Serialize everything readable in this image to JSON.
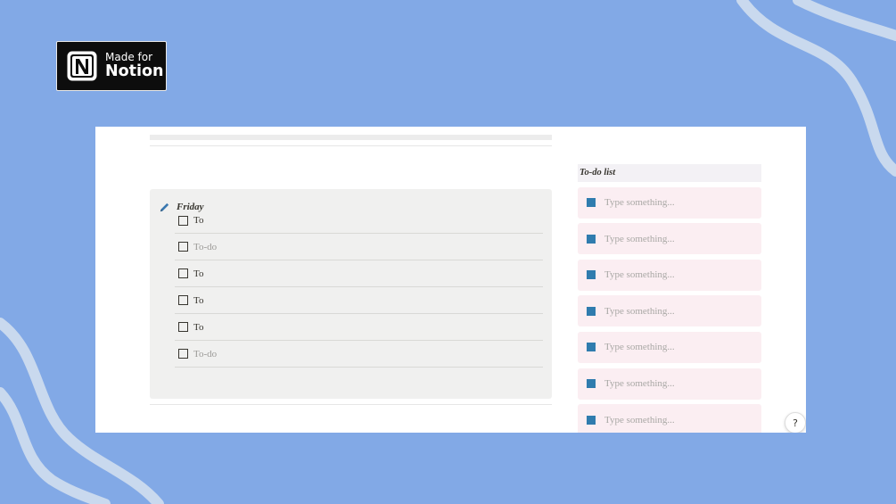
{
  "badge": {
    "line1": "Made for",
    "line2": "Notion",
    "logo_icon": "notion-logo-icon"
  },
  "day_block": {
    "title": "Friday",
    "icon": "pen-icon",
    "todos": [
      {
        "label": "To",
        "placeholder": false
      },
      {
        "label": "To-do",
        "placeholder": true
      },
      {
        "label": "To",
        "placeholder": false
      },
      {
        "label": "To",
        "placeholder": false
      },
      {
        "label": "To",
        "placeholder": false
      },
      {
        "label": "To-do",
        "placeholder": true
      }
    ]
  },
  "sidebar": {
    "title": "To-do list",
    "items": [
      {
        "text": "Type something..."
      },
      {
        "text": "Type something..."
      },
      {
        "text": "Type something..."
      },
      {
        "text": "Type something..."
      },
      {
        "text": "Type something..."
      },
      {
        "text": "Type something..."
      },
      {
        "text": "Type something..."
      }
    ]
  },
  "help": {
    "label": "?"
  },
  "colors": {
    "background": "#82a9e6",
    "wave": "#c9d9ee",
    "task_marker": "#2f7cae",
    "task_bg": "#fbeef2",
    "day_panel_bg": "#f0f0ef"
  }
}
